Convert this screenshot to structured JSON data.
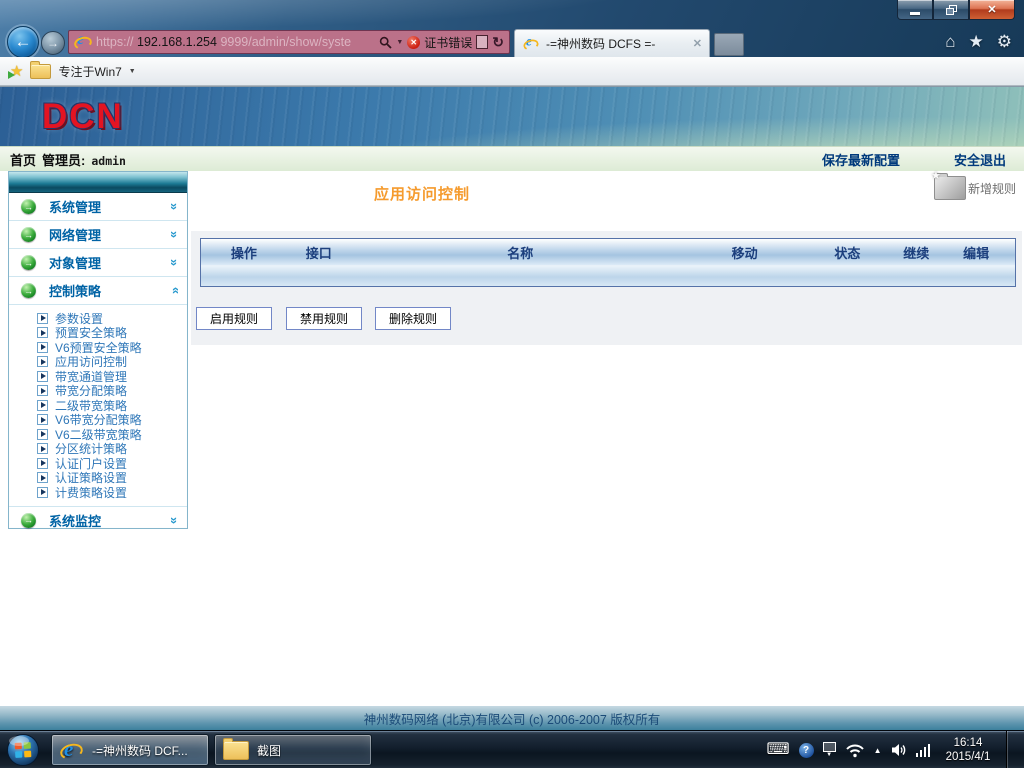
{
  "browser": {
    "window_controls": {
      "close_glyph": "✕"
    },
    "nav": {
      "url_protocol": "https://",
      "url_host": "192.168.1.254",
      "url_path": "9999/admin/show/syste",
      "cert_error_label": "证书错误",
      "tab_title": "-=神州数码 DCFS =-"
    },
    "favorites": {
      "label": "专注于Win7"
    }
  },
  "site": {
    "logo_text": "DCN",
    "statusbar": {
      "home": "首页",
      "admin_label": "管理员:",
      "admin_name": "admin",
      "save_link": "保存最新配置",
      "logout_link": "安全退出"
    },
    "sidebar": {
      "sections": [
        {
          "label": "系统管理",
          "expanded": false
        },
        {
          "label": "网络管理",
          "expanded": false
        },
        {
          "label": "对象管理",
          "expanded": false
        },
        {
          "label": "控制策略",
          "expanded": true
        },
        {
          "label": "系统监控",
          "expanded": false
        }
      ],
      "control_items": [
        "参数设置",
        "预置安全策略",
        "V6预置安全策略",
        "应用访问控制",
        "带宽通道管理",
        "带宽分配策略",
        "二级带宽策略",
        "V6带宽分配策略",
        "V6二级带宽策略",
        "分区统计策略",
        "认证门户设置",
        "认证策略设置",
        "计费策略设置"
      ]
    },
    "main": {
      "page_title": "应用访问控制",
      "add_rule_label": "新增规则",
      "table": {
        "headers": [
          "操作",
          "接口",
          "名称",
          "移动",
          "状态",
          "继续",
          "编辑"
        ],
        "rows": []
      },
      "buttons": [
        "启用规则",
        "禁用规则",
        "删除规则"
      ]
    },
    "footer_text": "神州数码网络 (北京)有限公司  (c) 2006-2007  版权所有"
  },
  "taskbar": {
    "ie_window_title": "-=神州数码 DCF...",
    "folder_window_title": "截图",
    "tray_time": "16:14",
    "tray_date": "2015/4/1"
  },
  "icons": {
    "back": "←",
    "forward": "→",
    "close": "✕",
    "refresh": "↻",
    "home": "⌂",
    "favorites_star": "★",
    "settings": "⚙",
    "dropdown": "▼",
    "chevron": "»",
    "menu_arrow": "→",
    "tray_keyboard": "⌨",
    "tray_help": "?",
    "tray_hidden": "▲"
  },
  "colors": {
    "logo_red": "#e31422",
    "title_orange": "#f59b2e",
    "menu_blue": "#0063a5",
    "link_navy": "#003a7c"
  }
}
